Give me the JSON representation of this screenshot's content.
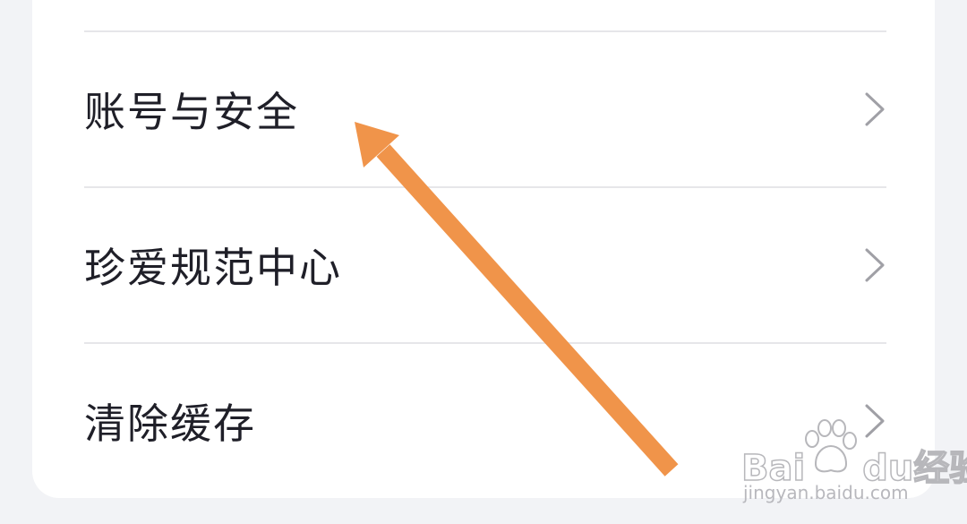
{
  "menu": {
    "items": [
      {
        "label": "账号与安全"
      },
      {
        "label": "珍爱规范中心"
      },
      {
        "label": "清除缓存"
      }
    ]
  },
  "annotation": {
    "arrow_color": "#f0944a"
  },
  "watermark": {
    "brand": "Bai",
    "brand_suffix": "du",
    "brand_cn": "经验",
    "url": "jingyan.baidu.com"
  },
  "colors": {
    "background": "#f2f3f6",
    "card": "#ffffff",
    "text": "#1f1f28",
    "chevron": "#a0a0a6",
    "divider": "#e6e6e9"
  }
}
